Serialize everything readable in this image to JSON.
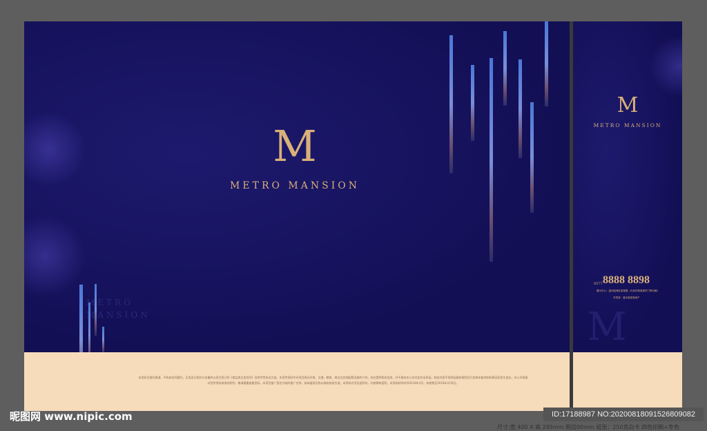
{
  "brand": {
    "monogram": "M",
    "name": "METRO MANSION"
  },
  "side": {
    "phone_prefix": "0577",
    "phone": "8888 8898",
    "address": "展示中心：温州瓯海区某某路（大西洋某某城东门斜对面）",
    "developer": "开发商：温州某某城地产"
  },
  "ghost_text": [
    "METRO",
    "MANSION"
  ],
  "disclaimer": [
    "本资料为要约邀请，不构成合同要约，买卖双方权利义务最终以双方签订的《商品房买卖合同》及附件等协议为准。本宣传资料中对项目周边环境、交通、教育、商业及其他配套设施的介绍，仅在提供相关信息，并不意味本公司对此作出承诺，相关内容不排除因政府规划及开发商未能控制的原因而发生变化，本公司保留",
    "对宣传资料修改的权利，敬请慎重查看资料。本项目推广案名为临时推广名称，具体备案名称以政府核准为准。本资料内涉及面积的，均按建筑面积。本资料制作时间2018年3月，有效期至2018年4月8日。"
  ],
  "watermark": {
    "site": "昵图网 www.nipic.com",
    "id": "ID:17188987 NO:20200818091526809082",
    "spec": "尺寸:宽 400 X 高 285mm 侧边90mm 纸张：250克白卡 四色印刷+专色"
  }
}
